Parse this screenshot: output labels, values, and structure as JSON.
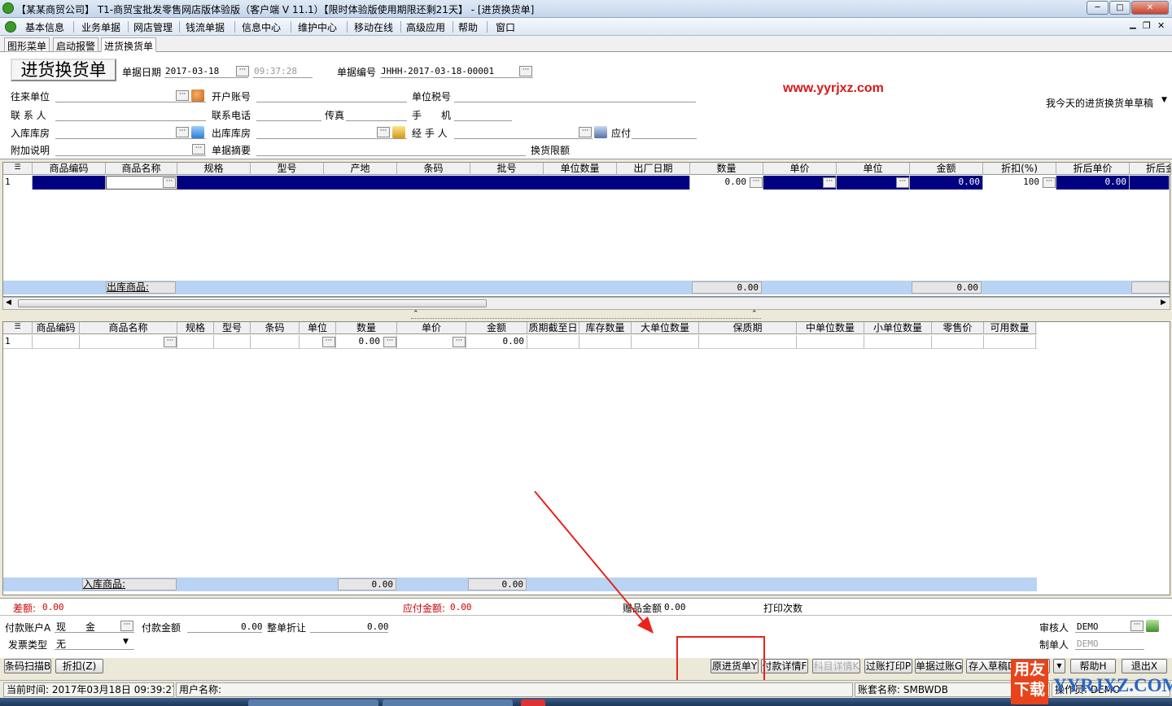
{
  "window": {
    "title": "【某某商贸公司】 T1-商贸宝批发零售网店版体验版（客户端 V 11.1）【限时体验版使用期限还剩21天】 - [进货换货单]",
    "min": "─",
    "max": "□",
    "close": "✕"
  },
  "menu": [
    "基本信息",
    "业务单据",
    "网店管理",
    "钱流单据",
    "信息中心",
    "维护中心",
    "移动在线",
    "高级应用",
    "帮助",
    "窗口"
  ],
  "menu_ctrl": {
    "min": "▁",
    "restore": "❐",
    "close": "✕"
  },
  "tabs": [
    "图形菜单",
    "启动报警",
    "进货换货单"
  ],
  "form": {
    "doc_title": "进货换货单",
    "date_label": "单据日期",
    "date_value": "2017-03-18",
    "time_value": "09:37:28",
    "docno_label": "单据编号",
    "docno_value": "JHHH-2017-03-18-00001",
    "partner_label": "往来单位",
    "bank_label": "开户账号",
    "tax_label": "单位税号",
    "contact_label": "联 系 人",
    "phone_label": "联系电话",
    "fax_label": "传真",
    "mobile_label": "手　　机",
    "in_wh_label": "入库库房",
    "out_wh_label": "出库库房",
    "handler_label": "经 手 人",
    "payable_label": "应付",
    "extra_label": "附加说明",
    "summary_label": "单据摘要",
    "limit_label": "换货限额",
    "watermark": "www.yyrjxz.com",
    "draft_select": "我今天的进货换货单草稿"
  },
  "grid1": {
    "columns": [
      "商品编码",
      "商品名称",
      "规格",
      "型号",
      "产地",
      "条码",
      "批号",
      "单位数量",
      "出厂日期",
      "数量",
      "单价",
      "单位",
      "金额",
      "折扣(%)",
      "折后单价",
      "折后金"
    ],
    "row": {
      "num": "1",
      "qty": "0.00",
      "amount": "0.00",
      "discount": "100",
      "disc_price": "0.00"
    },
    "sum_label": "出库商品:",
    "sum_qty": "0.00",
    "sum_amount": "0.00"
  },
  "grid2": {
    "columns": [
      "商品编码",
      "商品名称",
      "规格",
      "型号",
      "条码",
      "单位",
      "数量",
      "单价",
      "金额",
      "质期截至日",
      "库存数量",
      "大单位数量",
      "保质期",
      "中单位数量",
      "小单位数量",
      "零售价",
      "可用数量"
    ],
    "row": {
      "num": "1",
      "qty": "0.00",
      "amount": "0.00"
    },
    "sum_label": "入库商品:",
    "sum_qty": "0.00",
    "sum_amount": "0.00"
  },
  "totals": {
    "diff_label": "差额:",
    "diff_value": "0.00",
    "payable_total_label": "应付金额:",
    "payable_total_value": "0.00",
    "gift_label": "赠品金额",
    "gift_value": "0.00",
    "print_label": "打印次数"
  },
  "payment": {
    "account_label": "付款账户A",
    "account_value": "现　　金",
    "pay_amount_label": "付款金额",
    "pay_amount_value": "0.00",
    "discount_label": "整单折让",
    "discount_value": "0.00",
    "invoice_label": "发票类型",
    "invoice_value": "无",
    "auditor_label": "审核人",
    "auditor_value": "DEMO",
    "maker_label": "制单人",
    "maker_value": "DEMO"
  },
  "buttons": {
    "scan": "条码扫描B",
    "discount": "折扣(Z)",
    "orig": "原进货单Y",
    "pay_detail": "付款详情F",
    "subject_detail": "科目详情K",
    "post_print": "过账打印P",
    "post": "单据过账G",
    "save_draft": "存入草稿D",
    "help": "帮助H",
    "exit": "退出X"
  },
  "status": {
    "time": "当前时间: 2017年03月18日 09:39:27",
    "user": "用户名称:",
    "account": "账套名称: SMBWDB",
    "operator": "操作员: DEMO"
  },
  "badge": {
    "line1": "用友",
    "line2": "下载",
    "text": "YYRJXZ.COM"
  },
  "colors": {
    "selected_row": "#000080",
    "summary_row": "#b9d3f4",
    "diff_red": "#cc0000",
    "annotation_red": "#e8231c"
  }
}
